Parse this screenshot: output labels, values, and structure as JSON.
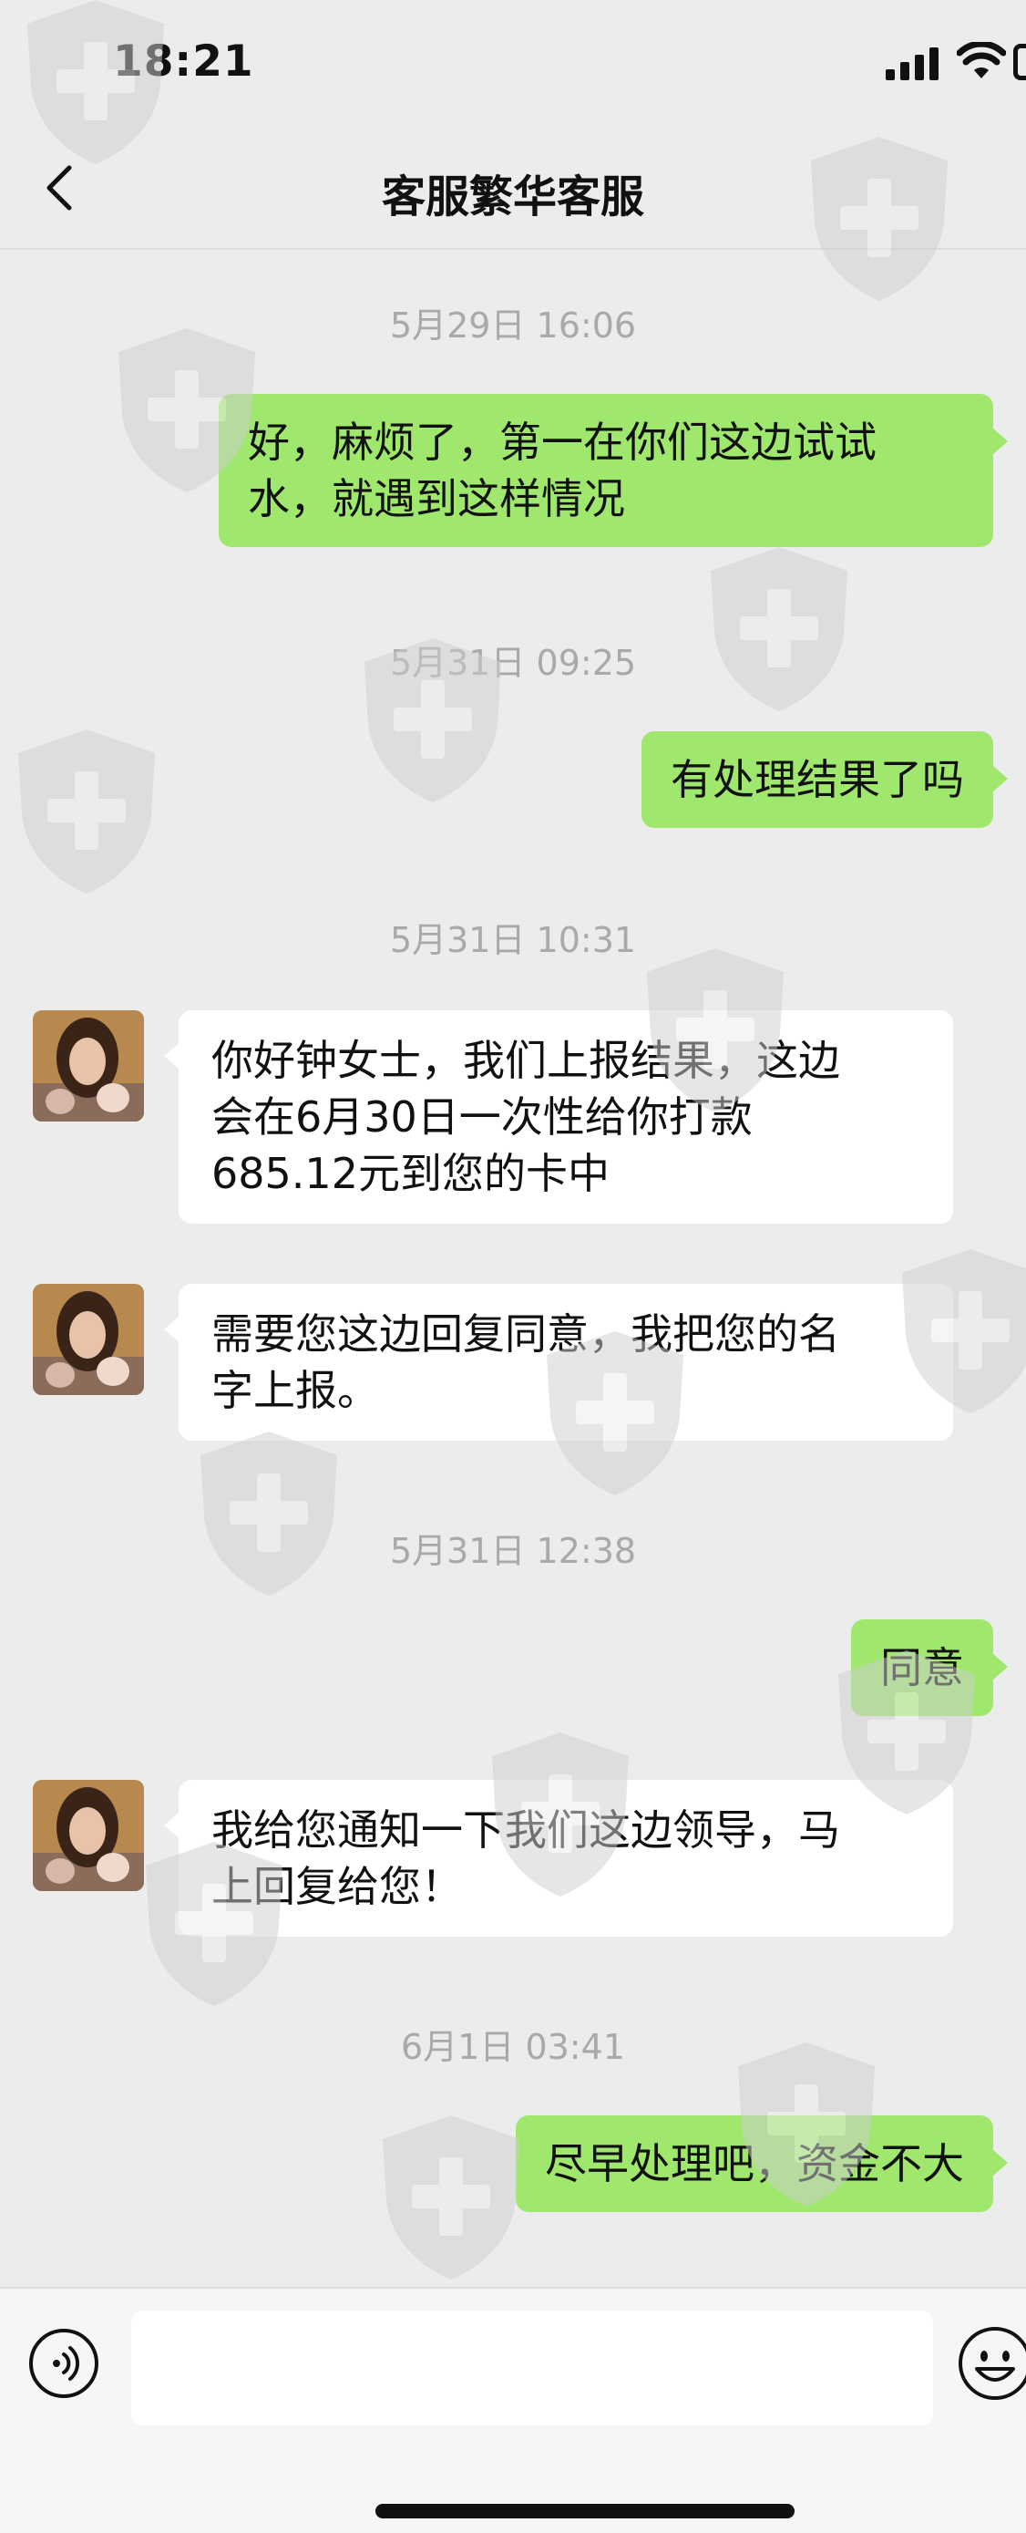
{
  "status_bar": {
    "time": "18:21"
  },
  "header": {
    "title": "客服繁华客服"
  },
  "colors": {
    "my_bubble": "#a0e76d",
    "their_bubble": "#ffffff",
    "background": "#ececec"
  },
  "messages": [
    {
      "type": "timestamp",
      "text": "5月29日 16:06"
    },
    {
      "type": "sent",
      "lines": [
        "好，麻烦了，第一在你们这边试试",
        "水，就遇到这样情况"
      ]
    },
    {
      "type": "timestamp",
      "text": "5月31日 09:25"
    },
    {
      "type": "sent",
      "lines": [
        "有处理结果了吗"
      ]
    },
    {
      "type": "timestamp",
      "text": "5月31日 10:31"
    },
    {
      "type": "received",
      "lines": [
        "你好钟女士，我们上报结果，这边",
        "会在6月30日一次性给你打款",
        "685.12元到您的卡中"
      ]
    },
    {
      "type": "received",
      "lines": [
        "需要您这边回复同意，我把您的名",
        "字上报。"
      ]
    },
    {
      "type": "timestamp",
      "text": "5月31日 12:38"
    },
    {
      "type": "sent",
      "lines": [
        "同意"
      ]
    },
    {
      "type": "received",
      "lines": [
        "我给您通知一下我们这边领导，马",
        "上回复给您！"
      ]
    },
    {
      "type": "timestamp",
      "text": "6月1日 03:41"
    },
    {
      "type": "sent",
      "lines": [
        "尽早处理吧，资金不大"
      ]
    }
  ],
  "input_bar": {
    "voice_icon": "voice-icon",
    "emoji_icon": "emoji-icon",
    "text_value": ""
  }
}
